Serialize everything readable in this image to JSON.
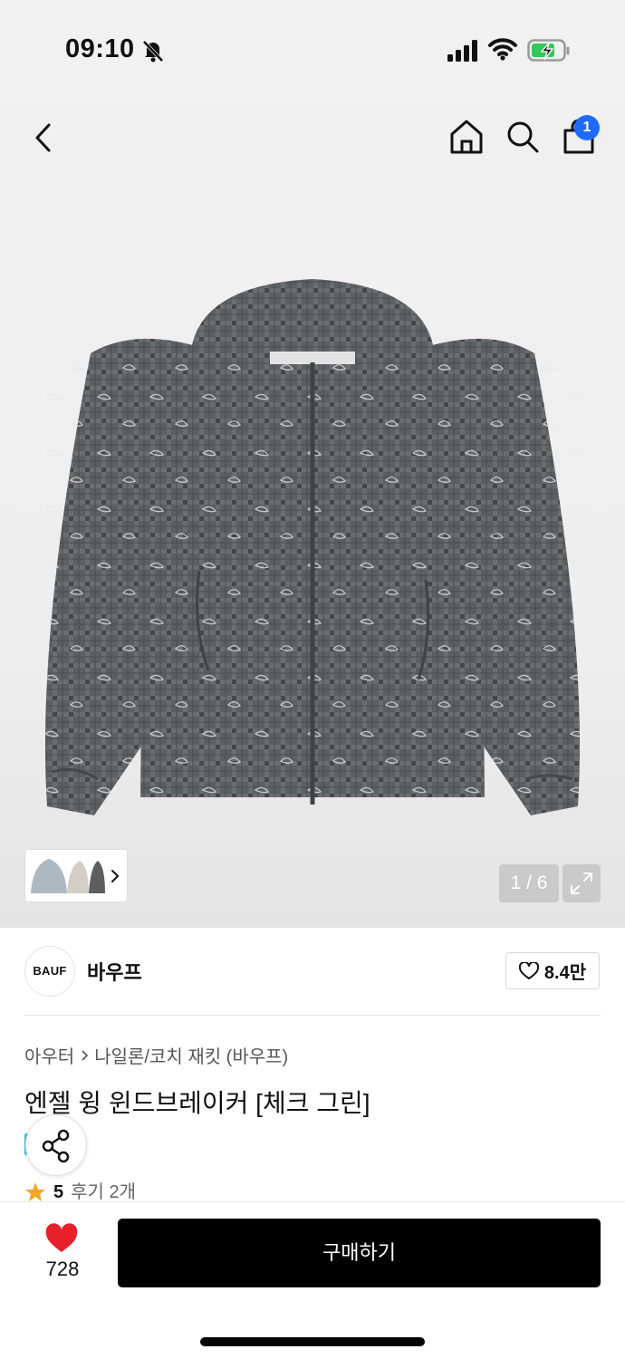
{
  "status_bar": {
    "time": "09:10",
    "icons": [
      "bell-off-icon",
      "signal-icon",
      "wifi-icon",
      "battery-charging-icon"
    ]
  },
  "top_nav": {
    "icons": [
      "back-icon",
      "home-icon",
      "search-icon",
      "bag-icon"
    ],
    "cart_badge": "1",
    "badge_color": "#1f6bff"
  },
  "gallery": {
    "page_indicator": "1 / 6",
    "icons": [
      "chevron-right-icon",
      "expand-icon"
    ]
  },
  "brand": {
    "logo_text": "BAUF",
    "name": "바우프",
    "like_count": "8.4만"
  },
  "product": {
    "breadcrumb": [
      "아우터",
      "나일론/코치 재킷 (바우프)"
    ],
    "title": "엔젤 윙 윈드브레이커 [체크 그린]",
    "rating_score": "5",
    "review_text": "후기 2개",
    "rating_star_color": "#f5a623"
  },
  "bottom_bar": {
    "wish_count": "728",
    "buy_label": "구매하기",
    "heart_color": "#e8202a",
    "buy_button_color": "#000000"
  }
}
